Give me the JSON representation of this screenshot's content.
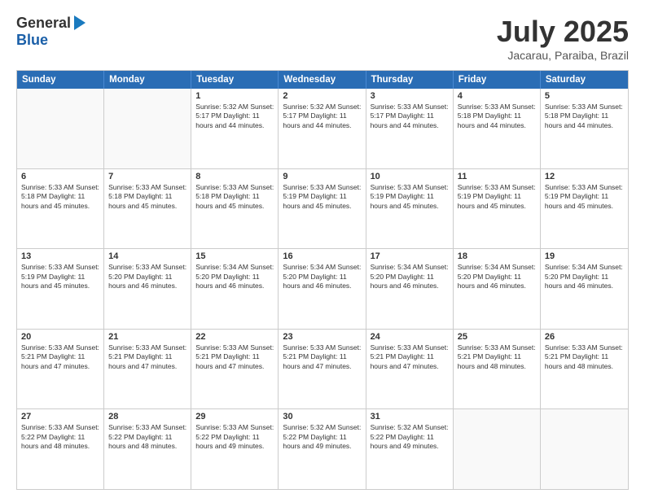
{
  "logo": {
    "general": "General",
    "blue": "Blue"
  },
  "title": "July 2025",
  "subtitle": "Jacarau, Paraiba, Brazil",
  "weekdays": [
    "Sunday",
    "Monday",
    "Tuesday",
    "Wednesday",
    "Thursday",
    "Friday",
    "Saturday"
  ],
  "weeks": [
    [
      {
        "day": "",
        "info": ""
      },
      {
        "day": "",
        "info": ""
      },
      {
        "day": "1",
        "info": "Sunrise: 5:32 AM\nSunset: 5:17 PM\nDaylight: 11 hours and 44 minutes."
      },
      {
        "day": "2",
        "info": "Sunrise: 5:32 AM\nSunset: 5:17 PM\nDaylight: 11 hours and 44 minutes."
      },
      {
        "day": "3",
        "info": "Sunrise: 5:33 AM\nSunset: 5:17 PM\nDaylight: 11 hours and 44 minutes."
      },
      {
        "day": "4",
        "info": "Sunrise: 5:33 AM\nSunset: 5:18 PM\nDaylight: 11 hours and 44 minutes."
      },
      {
        "day": "5",
        "info": "Sunrise: 5:33 AM\nSunset: 5:18 PM\nDaylight: 11 hours and 44 minutes."
      }
    ],
    [
      {
        "day": "6",
        "info": "Sunrise: 5:33 AM\nSunset: 5:18 PM\nDaylight: 11 hours and 45 minutes."
      },
      {
        "day": "7",
        "info": "Sunrise: 5:33 AM\nSunset: 5:18 PM\nDaylight: 11 hours and 45 minutes."
      },
      {
        "day": "8",
        "info": "Sunrise: 5:33 AM\nSunset: 5:18 PM\nDaylight: 11 hours and 45 minutes."
      },
      {
        "day": "9",
        "info": "Sunrise: 5:33 AM\nSunset: 5:19 PM\nDaylight: 11 hours and 45 minutes."
      },
      {
        "day": "10",
        "info": "Sunrise: 5:33 AM\nSunset: 5:19 PM\nDaylight: 11 hours and 45 minutes."
      },
      {
        "day": "11",
        "info": "Sunrise: 5:33 AM\nSunset: 5:19 PM\nDaylight: 11 hours and 45 minutes."
      },
      {
        "day": "12",
        "info": "Sunrise: 5:33 AM\nSunset: 5:19 PM\nDaylight: 11 hours and 45 minutes."
      }
    ],
    [
      {
        "day": "13",
        "info": "Sunrise: 5:33 AM\nSunset: 5:19 PM\nDaylight: 11 hours and 45 minutes."
      },
      {
        "day": "14",
        "info": "Sunrise: 5:33 AM\nSunset: 5:20 PM\nDaylight: 11 hours and 46 minutes."
      },
      {
        "day": "15",
        "info": "Sunrise: 5:34 AM\nSunset: 5:20 PM\nDaylight: 11 hours and 46 minutes."
      },
      {
        "day": "16",
        "info": "Sunrise: 5:34 AM\nSunset: 5:20 PM\nDaylight: 11 hours and 46 minutes."
      },
      {
        "day": "17",
        "info": "Sunrise: 5:34 AM\nSunset: 5:20 PM\nDaylight: 11 hours and 46 minutes."
      },
      {
        "day": "18",
        "info": "Sunrise: 5:34 AM\nSunset: 5:20 PM\nDaylight: 11 hours and 46 minutes."
      },
      {
        "day": "19",
        "info": "Sunrise: 5:34 AM\nSunset: 5:20 PM\nDaylight: 11 hours and 46 minutes."
      }
    ],
    [
      {
        "day": "20",
        "info": "Sunrise: 5:33 AM\nSunset: 5:21 PM\nDaylight: 11 hours and 47 minutes."
      },
      {
        "day": "21",
        "info": "Sunrise: 5:33 AM\nSunset: 5:21 PM\nDaylight: 11 hours and 47 minutes."
      },
      {
        "day": "22",
        "info": "Sunrise: 5:33 AM\nSunset: 5:21 PM\nDaylight: 11 hours and 47 minutes."
      },
      {
        "day": "23",
        "info": "Sunrise: 5:33 AM\nSunset: 5:21 PM\nDaylight: 11 hours and 47 minutes."
      },
      {
        "day": "24",
        "info": "Sunrise: 5:33 AM\nSunset: 5:21 PM\nDaylight: 11 hours and 47 minutes."
      },
      {
        "day": "25",
        "info": "Sunrise: 5:33 AM\nSunset: 5:21 PM\nDaylight: 11 hours and 48 minutes."
      },
      {
        "day": "26",
        "info": "Sunrise: 5:33 AM\nSunset: 5:21 PM\nDaylight: 11 hours and 48 minutes."
      }
    ],
    [
      {
        "day": "27",
        "info": "Sunrise: 5:33 AM\nSunset: 5:22 PM\nDaylight: 11 hours and 48 minutes."
      },
      {
        "day": "28",
        "info": "Sunrise: 5:33 AM\nSunset: 5:22 PM\nDaylight: 11 hours and 48 minutes."
      },
      {
        "day": "29",
        "info": "Sunrise: 5:33 AM\nSunset: 5:22 PM\nDaylight: 11 hours and 49 minutes."
      },
      {
        "day": "30",
        "info": "Sunrise: 5:32 AM\nSunset: 5:22 PM\nDaylight: 11 hours and 49 minutes."
      },
      {
        "day": "31",
        "info": "Sunrise: 5:32 AM\nSunset: 5:22 PM\nDaylight: 11 hours and 49 minutes."
      },
      {
        "day": "",
        "info": ""
      },
      {
        "day": "",
        "info": ""
      }
    ]
  ]
}
